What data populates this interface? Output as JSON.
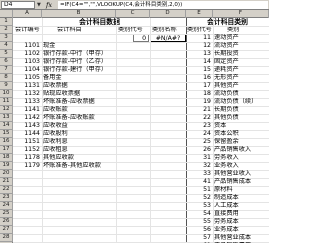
{
  "formula_bar": {
    "name_box": "D4",
    "fx_label": "fx",
    "formula": "=IF(C4=\"\",\"\",VLOOKUP(C4,会计科目类别,2,0))"
  },
  "columns": [
    "A",
    "B",
    "C",
    "D",
    "E",
    "F"
  ],
  "rows": [
    "1",
    "2",
    "3",
    "4",
    "5",
    "6",
    "7",
    "8",
    "9",
    "10",
    "11",
    "12",
    "13",
    "14",
    "15",
    "16",
    "17",
    "18",
    "19",
    "20",
    "21",
    "22",
    "23",
    "24",
    "25",
    "26",
    "27",
    "28"
  ],
  "left_table": {
    "title": "会计科目数据",
    "headers": [
      "会计编号",
      "会计科目",
      "类别代号",
      "类别名称"
    ],
    "selected_value": "#N/A#?",
    "selected_code": "0",
    "items": [
      {
        "code": "1101",
        "name": "现金"
      },
      {
        "code": "1102",
        "name": "银行存款-中行（甲存）"
      },
      {
        "code": "1103",
        "name": "银行存款-中行（乙存）"
      },
      {
        "code": "1104",
        "name": "银行存款-建行（甲存）"
      },
      {
        "code": "1105",
        "name": "备用金"
      },
      {
        "code": "1131",
        "name": "应收票据"
      },
      {
        "code": "1132",
        "name": "贴现应收票据"
      },
      {
        "code": "1133",
        "name": "坏账准备-应收票据"
      },
      {
        "code": "1141",
        "name": "应收账款"
      },
      {
        "code": "1142",
        "name": "坏账准备-应收账款"
      },
      {
        "code": "1143",
        "name": "应收收益"
      },
      {
        "code": "1144",
        "name": "应收股利"
      },
      {
        "code": "1151",
        "name": "应收利息"
      },
      {
        "code": "1152",
        "name": "应收租息"
      },
      {
        "code": "1178",
        "name": "其他应收款"
      },
      {
        "code": "1179",
        "name": "坏账准备-其他应收款"
      }
    ]
  },
  "right_table": {
    "title": "会计科目类别",
    "headers": [
      "类别代号",
      "类别"
    ],
    "items": [
      {
        "code": "11",
        "name": "速动资产"
      },
      {
        "code": "12",
        "name": "流动资产"
      },
      {
        "code": "13",
        "name": "长期投资"
      },
      {
        "code": "14",
        "name": "固定资产"
      },
      {
        "code": "15",
        "name": "递耗资产"
      },
      {
        "code": "16",
        "name": "无形资产"
      },
      {
        "code": "17",
        "name": "其他资产"
      },
      {
        "code": "18",
        "name": "流动负债"
      },
      {
        "code": "19",
        "name": "流动负债（续）"
      },
      {
        "code": "21",
        "name": "长期负债"
      },
      {
        "code": "22",
        "name": "其他负债"
      },
      {
        "code": "23",
        "name": "资本"
      },
      {
        "code": "24",
        "name": "资本公积"
      },
      {
        "code": "25",
        "name": "保留盈余"
      },
      {
        "code": "26",
        "name": "产品销售收入"
      },
      {
        "code": "31",
        "name": "劳务收入"
      },
      {
        "code": "32",
        "name": "业务收入"
      },
      {
        "code": "33",
        "name": "其他营业收入"
      },
      {
        "code": "41",
        "name": "产品销售成本"
      },
      {
        "code": "51",
        "name": "原材料"
      },
      {
        "code": "52",
        "name": "制造成本"
      },
      {
        "code": "53",
        "name": "人工成本"
      },
      {
        "code": "54",
        "name": "直接费用"
      },
      {
        "code": "55",
        "name": "劳务成本"
      },
      {
        "code": "56",
        "name": "业务成本"
      },
      {
        "code": "57",
        "name": "其他营业成本"
      },
      {
        "code": "61",
        "name": "产品销售费用"
      }
    ]
  }
}
